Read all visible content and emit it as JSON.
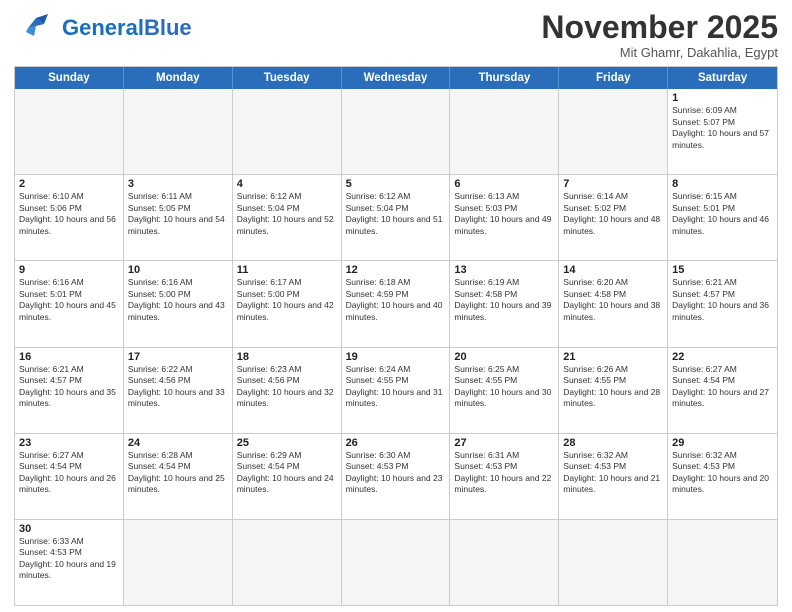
{
  "header": {
    "logo_general": "General",
    "logo_blue": "Blue",
    "month_title": "November 2025",
    "location": "Mit Ghamr, Dakahlia, Egypt"
  },
  "weekdays": [
    "Sunday",
    "Monday",
    "Tuesday",
    "Wednesday",
    "Thursday",
    "Friday",
    "Saturday"
  ],
  "rows": [
    [
      {
        "day": "",
        "info": "",
        "empty": true
      },
      {
        "day": "",
        "info": "",
        "empty": true
      },
      {
        "day": "",
        "info": "",
        "empty": true
      },
      {
        "day": "",
        "info": "",
        "empty": true
      },
      {
        "day": "",
        "info": "",
        "empty": true
      },
      {
        "day": "",
        "info": "",
        "empty": true
      },
      {
        "day": "1",
        "info": "Sunrise: 6:09 AM\nSunset: 5:07 PM\nDaylight: 10 hours and 57 minutes.",
        "empty": false
      }
    ],
    [
      {
        "day": "2",
        "info": "Sunrise: 6:10 AM\nSunset: 5:06 PM\nDaylight: 10 hours and 56 minutes.",
        "empty": false
      },
      {
        "day": "3",
        "info": "Sunrise: 6:11 AM\nSunset: 5:05 PM\nDaylight: 10 hours and 54 minutes.",
        "empty": false
      },
      {
        "day": "4",
        "info": "Sunrise: 6:12 AM\nSunset: 5:04 PM\nDaylight: 10 hours and 52 minutes.",
        "empty": false
      },
      {
        "day": "5",
        "info": "Sunrise: 6:12 AM\nSunset: 5:04 PM\nDaylight: 10 hours and 51 minutes.",
        "empty": false
      },
      {
        "day": "6",
        "info": "Sunrise: 6:13 AM\nSunset: 5:03 PM\nDaylight: 10 hours and 49 minutes.",
        "empty": false
      },
      {
        "day": "7",
        "info": "Sunrise: 6:14 AM\nSunset: 5:02 PM\nDaylight: 10 hours and 48 minutes.",
        "empty": false
      },
      {
        "day": "8",
        "info": "Sunrise: 6:15 AM\nSunset: 5:01 PM\nDaylight: 10 hours and 46 minutes.",
        "empty": false
      }
    ],
    [
      {
        "day": "9",
        "info": "Sunrise: 6:16 AM\nSunset: 5:01 PM\nDaylight: 10 hours and 45 minutes.",
        "empty": false
      },
      {
        "day": "10",
        "info": "Sunrise: 6:16 AM\nSunset: 5:00 PM\nDaylight: 10 hours and 43 minutes.",
        "empty": false
      },
      {
        "day": "11",
        "info": "Sunrise: 6:17 AM\nSunset: 5:00 PM\nDaylight: 10 hours and 42 minutes.",
        "empty": false
      },
      {
        "day": "12",
        "info": "Sunrise: 6:18 AM\nSunset: 4:59 PM\nDaylight: 10 hours and 40 minutes.",
        "empty": false
      },
      {
        "day": "13",
        "info": "Sunrise: 6:19 AM\nSunset: 4:58 PM\nDaylight: 10 hours and 39 minutes.",
        "empty": false
      },
      {
        "day": "14",
        "info": "Sunrise: 6:20 AM\nSunset: 4:58 PM\nDaylight: 10 hours and 38 minutes.",
        "empty": false
      },
      {
        "day": "15",
        "info": "Sunrise: 6:21 AM\nSunset: 4:57 PM\nDaylight: 10 hours and 36 minutes.",
        "empty": false
      }
    ],
    [
      {
        "day": "16",
        "info": "Sunrise: 6:21 AM\nSunset: 4:57 PM\nDaylight: 10 hours and 35 minutes.",
        "empty": false
      },
      {
        "day": "17",
        "info": "Sunrise: 6:22 AM\nSunset: 4:56 PM\nDaylight: 10 hours and 33 minutes.",
        "empty": false
      },
      {
        "day": "18",
        "info": "Sunrise: 6:23 AM\nSunset: 4:56 PM\nDaylight: 10 hours and 32 minutes.",
        "empty": false
      },
      {
        "day": "19",
        "info": "Sunrise: 6:24 AM\nSunset: 4:55 PM\nDaylight: 10 hours and 31 minutes.",
        "empty": false
      },
      {
        "day": "20",
        "info": "Sunrise: 6:25 AM\nSunset: 4:55 PM\nDaylight: 10 hours and 30 minutes.",
        "empty": false
      },
      {
        "day": "21",
        "info": "Sunrise: 6:26 AM\nSunset: 4:55 PM\nDaylight: 10 hours and 28 minutes.",
        "empty": false
      },
      {
        "day": "22",
        "info": "Sunrise: 6:27 AM\nSunset: 4:54 PM\nDaylight: 10 hours and 27 minutes.",
        "empty": false
      }
    ],
    [
      {
        "day": "23",
        "info": "Sunrise: 6:27 AM\nSunset: 4:54 PM\nDaylight: 10 hours and 26 minutes.",
        "empty": false
      },
      {
        "day": "24",
        "info": "Sunrise: 6:28 AM\nSunset: 4:54 PM\nDaylight: 10 hours and 25 minutes.",
        "empty": false
      },
      {
        "day": "25",
        "info": "Sunrise: 6:29 AM\nSunset: 4:54 PM\nDaylight: 10 hours and 24 minutes.",
        "empty": false
      },
      {
        "day": "26",
        "info": "Sunrise: 6:30 AM\nSunset: 4:53 PM\nDaylight: 10 hours and 23 minutes.",
        "empty": false
      },
      {
        "day": "27",
        "info": "Sunrise: 6:31 AM\nSunset: 4:53 PM\nDaylight: 10 hours and 22 minutes.",
        "empty": false
      },
      {
        "day": "28",
        "info": "Sunrise: 6:32 AM\nSunset: 4:53 PM\nDaylight: 10 hours and 21 minutes.",
        "empty": false
      },
      {
        "day": "29",
        "info": "Sunrise: 6:32 AM\nSunset: 4:53 PM\nDaylight: 10 hours and 20 minutes.",
        "empty": false
      }
    ],
    [
      {
        "day": "30",
        "info": "Sunrise: 6:33 AM\nSunset: 4:53 PM\nDaylight: 10 hours and 19 minutes.",
        "empty": false
      },
      {
        "day": "",
        "info": "",
        "empty": true
      },
      {
        "day": "",
        "info": "",
        "empty": true
      },
      {
        "day": "",
        "info": "",
        "empty": true
      },
      {
        "day": "",
        "info": "",
        "empty": true
      },
      {
        "day": "",
        "info": "",
        "empty": true
      },
      {
        "day": "",
        "info": "",
        "empty": true
      }
    ]
  ]
}
